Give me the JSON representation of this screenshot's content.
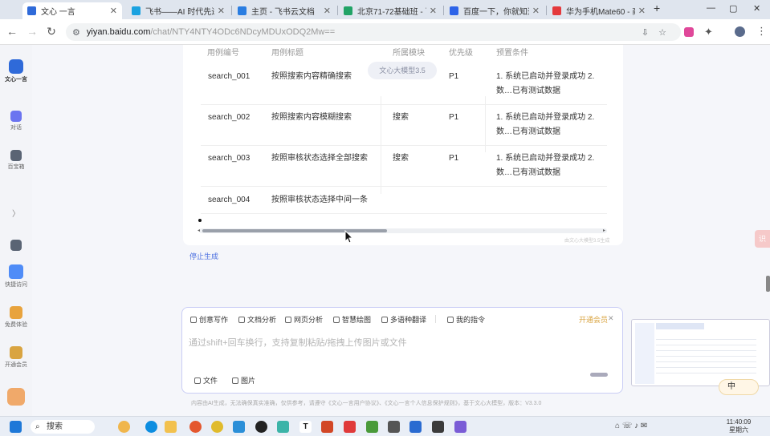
{
  "browser": {
    "tabs": [
      {
        "label": "文心 一言",
        "active": true,
        "color": "#2f6ad9"
      },
      {
        "label": "飞书——AI 时代先进…",
        "active": false,
        "color": "#1aa2e0"
      },
      {
        "label": "主页 - 飞书云文档",
        "active": false,
        "color": "#2a7de1"
      },
      {
        "label": "北京71-72基础班 - 飞…",
        "active": false,
        "color": "#21a366"
      },
      {
        "label": "百度一下，你就知道",
        "active": false,
        "color": "#2d63e8"
      },
      {
        "label": "华为手机Mate60 - 商…",
        "active": false,
        "color": "#e4393c"
      }
    ],
    "new_tab": "+",
    "close_glyph": "✕",
    "window_controls": {
      "minimize": "—",
      "maximize": "▢",
      "close": "✕"
    },
    "url_host": "yiyan.baidu.com",
    "url_path": "/chat/NTY4NTY4ODc6NDcyMDUxODQ2Mw=="
  },
  "sidebar": {
    "logo_label": "文心一言",
    "items": [
      {
        "label": "对话",
        "color": "#6b74f0"
      },
      {
        "label": "百宝箱",
        "color": "#5a6474"
      },
      {
        "label": "",
        "color": "#5a6474"
      },
      {
        "label": "快捷访问",
        "color": "#4f8cf7"
      },
      {
        "label": "免费体验",
        "color": "#e8a33d"
      },
      {
        "label": "开通会员",
        "color": "#d9a441"
      }
    ],
    "collapse_glyph": "〉"
  },
  "table": {
    "headers": [
      "用例编号",
      "用例标题",
      "所属模块",
      "优先级",
      "预置条件"
    ],
    "rows": [
      {
        "id": "search_001",
        "title": "按照搜索内容精确搜索",
        "module": "",
        "priority": "P1",
        "precondition": "1. 系统已启动并登录成功 2. 数…已有测试数据"
      },
      {
        "id": "search_002",
        "title": "按照搜索内容模糊搜索",
        "module": "搜索",
        "priority": "P1",
        "precondition": "1. 系统已启动并登录成功 2. 数…已有测试数据"
      },
      {
        "id": "search_003",
        "title": "按照审核状态选择全部搜索",
        "module": "搜索",
        "priority": "P1",
        "precondition": "1. 系统已启动并登录成功 2. 数…已有测试数据"
      },
      {
        "id": "search_004",
        "title": "按照审核状态选择中间一条",
        "module": "",
        "priority": "",
        "precondition": ""
      }
    ],
    "model_badge": "文心大模型3.5",
    "footnote": "由文心大模型3.5生成",
    "scroll_position": 0.46
  },
  "stop_generating": "停止生成",
  "composer": {
    "tools": [
      "创意写作",
      "文档分析",
      "网页分析",
      "智慧绘图",
      "多语种翻译",
      "我的指令"
    ],
    "member_link": "开通会员",
    "close_glyph": "✕",
    "placeholder": "通过shift+回车换行，支持复制粘贴/拖拽上传图片或文件",
    "file_button": "文件",
    "image_button": "图片"
  },
  "disclaimer": "内容由AI生成，无法确保真实准确，仅供参考，请遵守《文心一言用户协议》、《文心一言个人信息保护规则》，基于文心大模型，版本：V3.3.0",
  "ime": "中",
  "side_tab": "识",
  "taskbar": {
    "search": "搜索",
    "time": "11:40:09",
    "date": "星期六"
  }
}
